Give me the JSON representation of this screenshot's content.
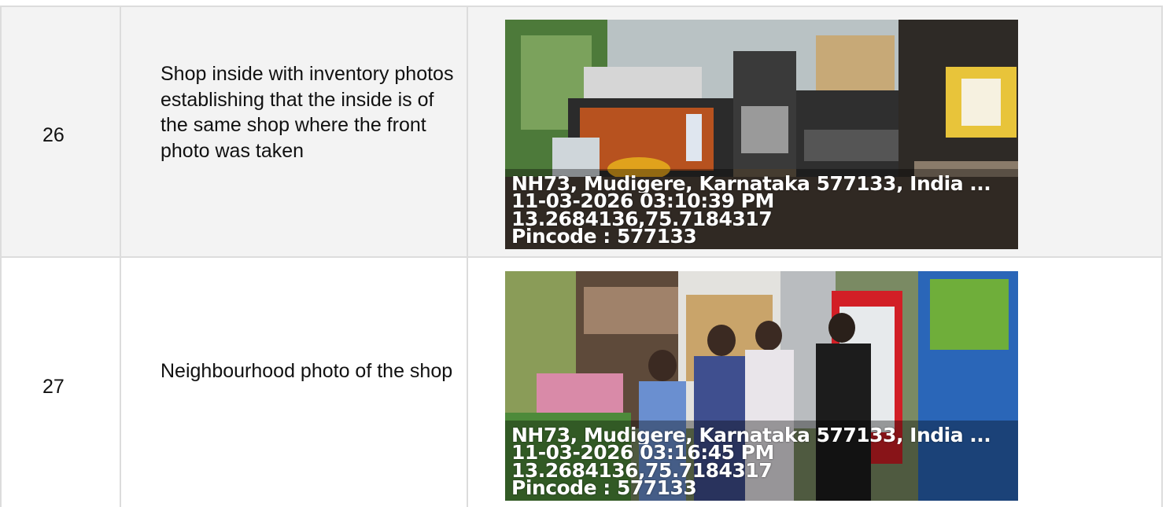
{
  "rows": [
    {
      "number": "26",
      "description": "Shop inside with inventory photos establishing that the inside is of the same shop where the front photo was taken",
      "photo": {
        "address": "NH73, Mudigere, Karnataka 577133, India ...",
        "datetime": "11-03-2026 03:10:39 PM",
        "coordinates": "13.2684136,75.7184317",
        "pincode": "Pincode : 577133"
      }
    },
    {
      "number": "27",
      "description": "Neighbourhood photo of the shop",
      "photo": {
        "address": "NH73, Mudigere, Karnataka 577133, India ...",
        "datetime": "11-03-2026 03:16:45 PM",
        "coordinates": "13.2684136,75.7184317",
        "pincode": "Pincode : 577133"
      }
    }
  ],
  "colors": {
    "row_shade": "#f3f3f3",
    "border": "#dcdcdc",
    "text": "#111111"
  }
}
